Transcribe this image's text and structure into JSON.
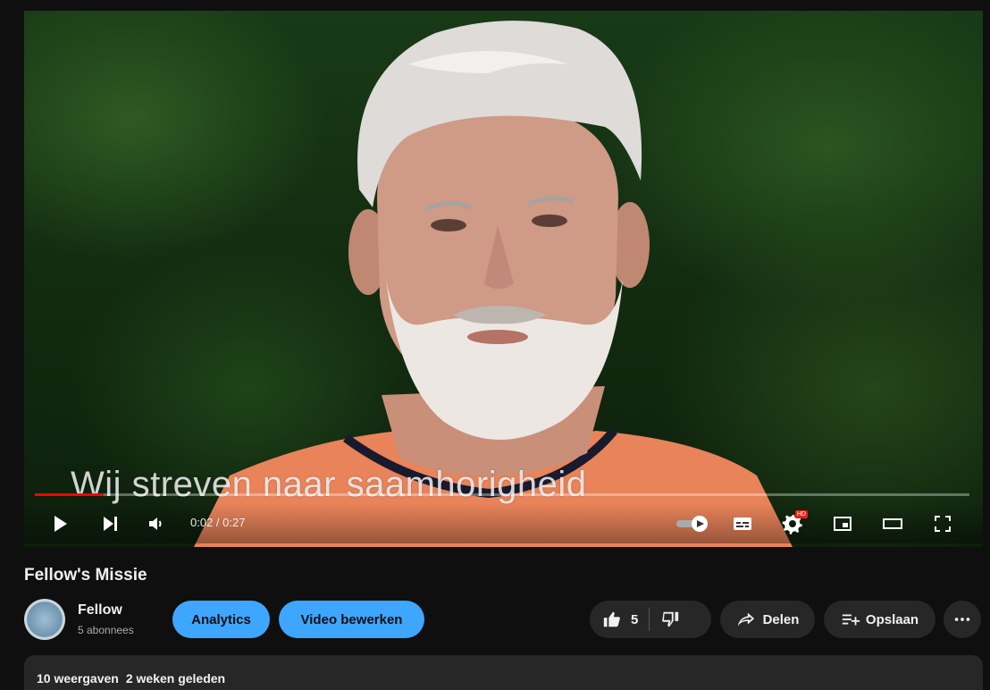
{
  "player": {
    "caption": "Wij streven naar saamhorigheid",
    "time_current": "0:02",
    "time_separator": " / ",
    "time_total": "0:27",
    "progress": 0.074,
    "settings_badge": "HD"
  },
  "video": {
    "title": "Fellow's Missie"
  },
  "channel": {
    "name": "Fellow",
    "subscribers": "5 abonnees"
  },
  "actions": {
    "analytics_label": "Analytics",
    "edit_label": "Video bewerken",
    "like_count": "5",
    "share_label": "Delen",
    "save_label": "Opslaan"
  },
  "description": {
    "views": "10 weergaven",
    "date": "2 weken geleden"
  },
  "colors": {
    "accent_blue": "#3ea6ff",
    "progress_red": "#ff0000",
    "pill_dark": "#272727",
    "background": "#0f0f0f"
  }
}
